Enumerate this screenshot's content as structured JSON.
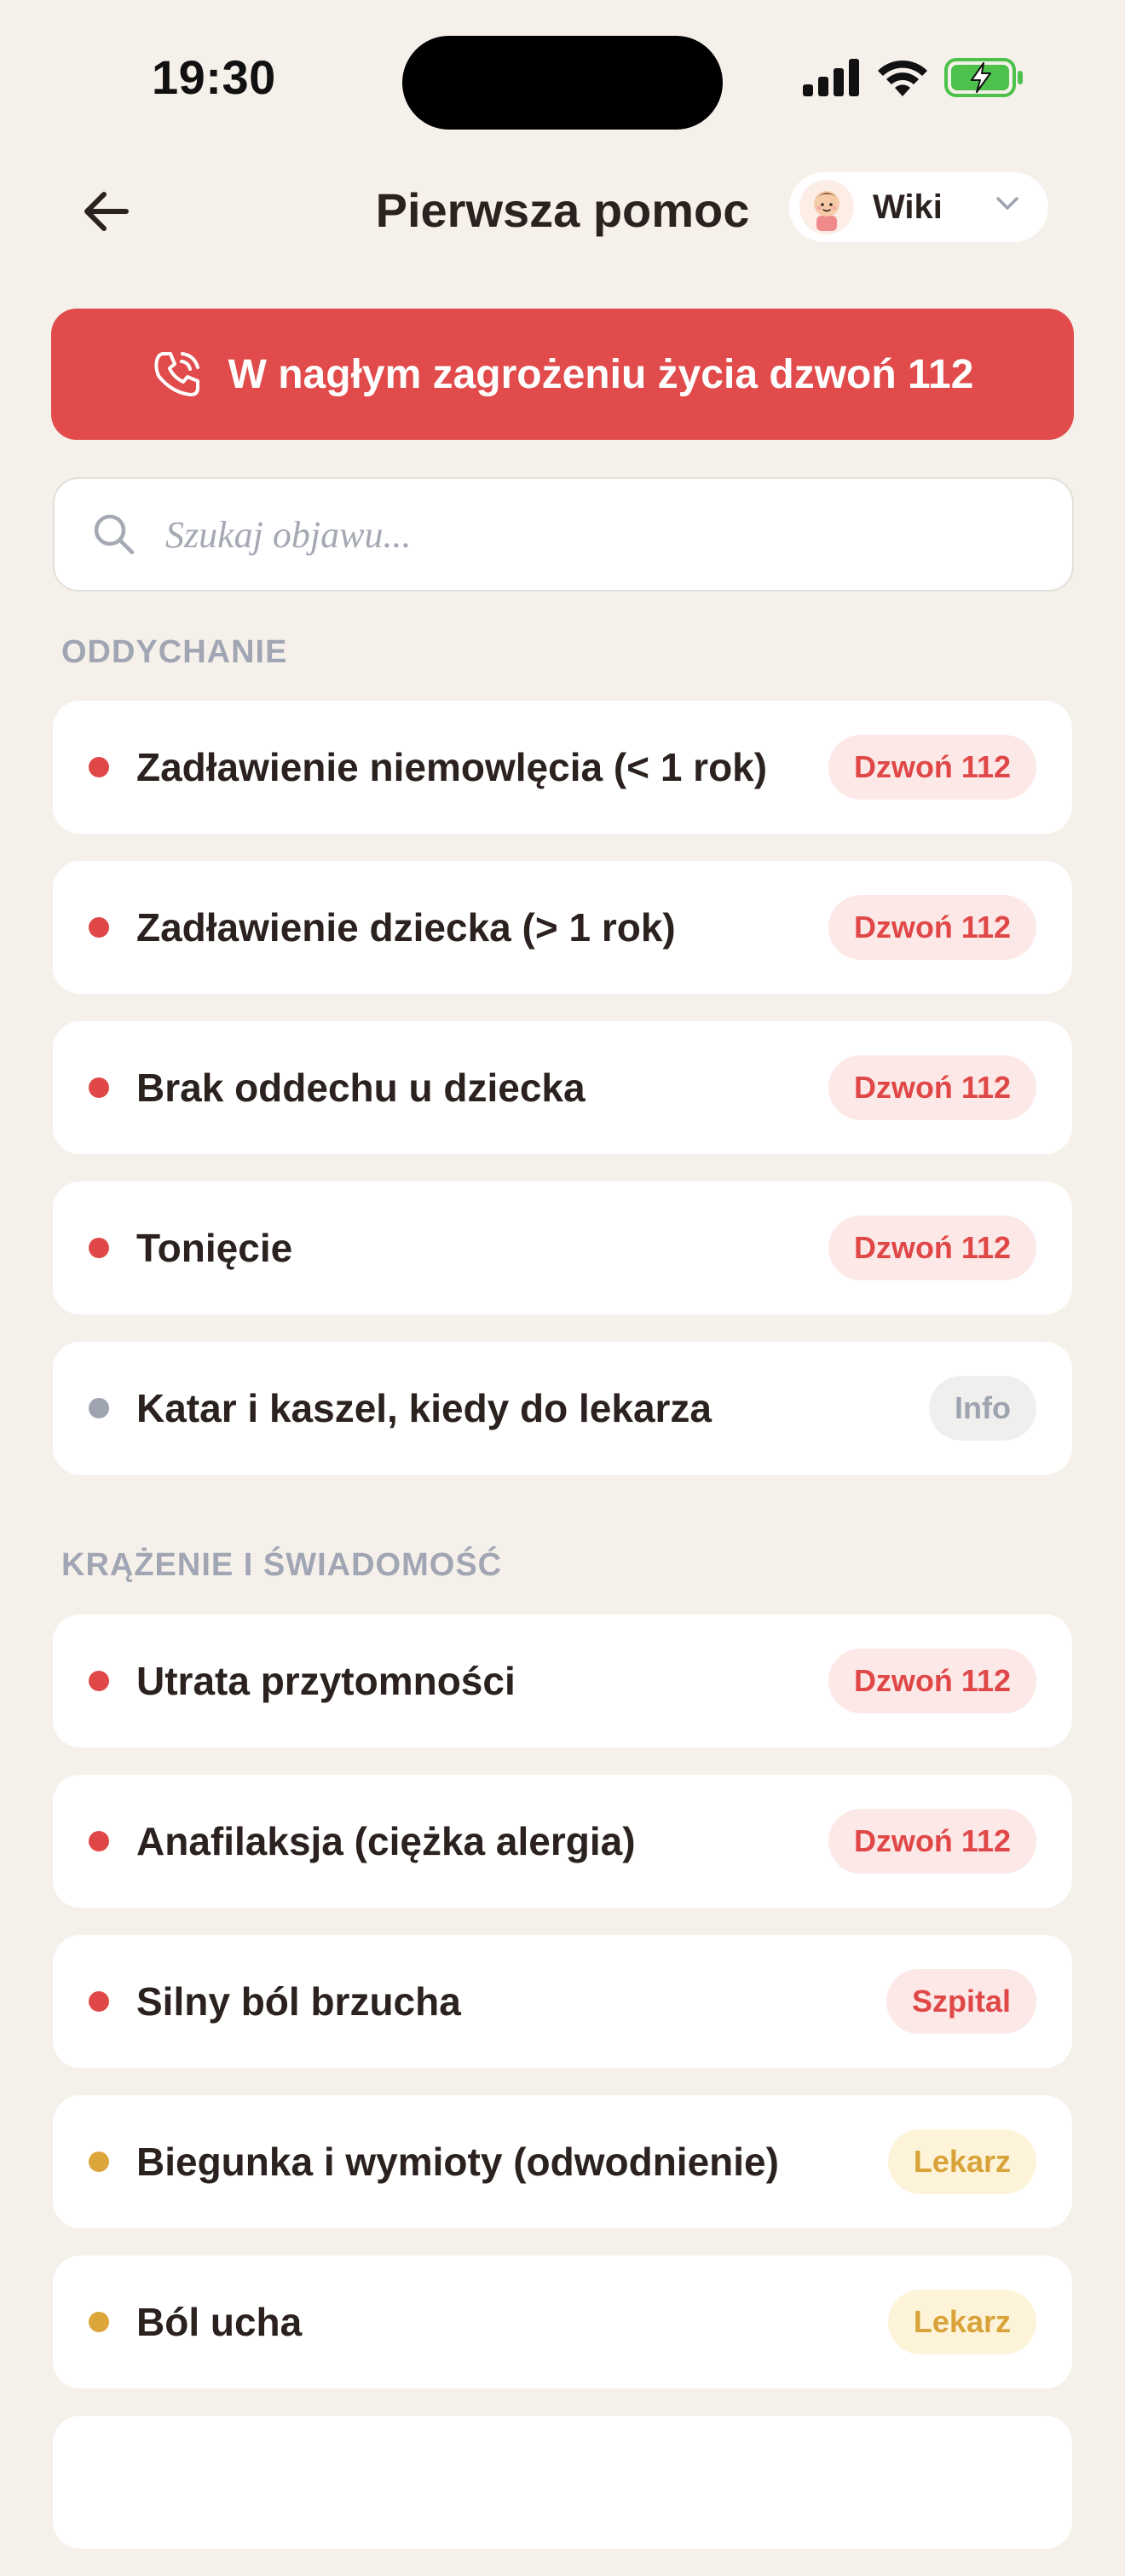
{
  "status_bar": {
    "time": "19:30"
  },
  "header": {
    "title": "Pierwsza pomoc",
    "profile_name": "Wiki"
  },
  "emergency": {
    "label": "W nagłym zagrożeniu życia dzwoń 112"
  },
  "search": {
    "placeholder": "Szukaj objawu..."
  },
  "colors": {
    "accent_red": "#E14B4B",
    "dot_red": "#E04848",
    "dot_gray": "#9EA3B0",
    "dot_amber": "#DCA63B",
    "badge_red_bg": "#FDE8E8",
    "badge_red_text": "#E04848",
    "badge_gray_bg": "#F1EFEE",
    "badge_gray_text": "#9EA3B0",
    "badge_amber_bg": "#FDF3D8",
    "badge_amber_text": "#D9A33A",
    "background": "#F6F0EA"
  },
  "sections": [
    {
      "title": "ODDYCHANIE",
      "items": [
        {
          "label": "Zadławienie niemowlęcia (< 1 rok)",
          "badge": "Dzwoń 112",
          "severity": "red"
        },
        {
          "label": "Zadławienie dziecka (> 1 rok)",
          "badge": "Dzwoń 112",
          "severity": "red"
        },
        {
          "label": "Brak oddechu u dziecka",
          "badge": "Dzwoń 112",
          "severity": "red"
        },
        {
          "label": "Tonięcie",
          "badge": "Dzwoń 112",
          "severity": "red"
        },
        {
          "label": "Katar i kaszel, kiedy do lekarza",
          "badge": "Info",
          "severity": "gray"
        }
      ]
    },
    {
      "title": "KRĄŻENIE I ŚWIADOMOŚĆ",
      "items": [
        {
          "label": "Utrata przytomności",
          "badge": "Dzwoń 112",
          "severity": "red"
        },
        {
          "label": "Anafilaksja (ciężka alergia)",
          "badge": "Dzwoń 112",
          "severity": "red"
        },
        {
          "label": "Silny ból brzucha",
          "badge": "Szpital",
          "severity": "red"
        },
        {
          "label": "Biegunka i wymioty (odwodnienie)",
          "badge": "Lekarz",
          "severity": "amber"
        },
        {
          "label": "Ból ucha",
          "badge": "Lekarz",
          "severity": "amber"
        }
      ]
    }
  ]
}
